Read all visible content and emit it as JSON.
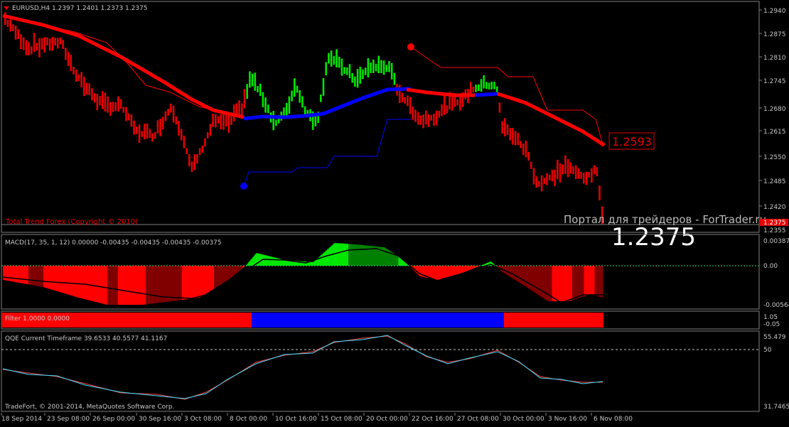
{
  "colors": {
    "background": "#000000",
    "panel_border": "#808080",
    "text": "#c8c8c8",
    "bull": "#00e600",
    "bear": "#e60000",
    "bear_dark": "#800000",
    "bull_dark": "#008000",
    "blue": "#0000ff",
    "red": "#ff0000",
    "qqe_line1": "#ff4040",
    "qqe_line2": "#40e0ff"
  },
  "main": {
    "symbol_arrow_icon": "triangle-down",
    "header": "EURUSD,H4  1.2397 1.2401 1.2373 1.2375",
    "indicator_name": "Total Trend Forex (Copyright © 2010)",
    "watermark": "Портал для трейдеров - ForTrader.ru",
    "big_price": "1.2375",
    "ma_label": "1.2593",
    "current_price_tag": "1.2375",
    "price_axis": [
      "1.2940",
      "1.2875",
      "1.2810",
      "1.2745",
      "1.2680",
      "1.2615",
      "1.2550",
      "1.2485",
      "1.2420",
      "1.2355"
    ]
  },
  "macd": {
    "header": "MACD(17, 35, 1, 12) 0.00000 -0.00435 -0.00435 -0.00435 -0.00375",
    "axis": [
      "0.00387",
      "0.00",
      "-0.00564"
    ]
  },
  "filter": {
    "header": "Filter 1.0000 0.0000",
    "axis": [
      "1.05",
      "-0.05"
    ],
    "segments": [
      {
        "state": "bear",
        "from": "18 Sep 2014",
        "to": "8 Oct 00:00"
      },
      {
        "state": "bull",
        "from": "8 Oct 00:00",
        "to": "30 Oct 00:00"
      },
      {
        "state": "bear",
        "from": "30 Oct 00:00",
        "to": "6 Nov 08:00"
      }
    ]
  },
  "qqe": {
    "header": "QQE Current Timeframe 39.6533 40.5577 41.1167",
    "axis": [
      "55.479",
      "50",
      "31.7465"
    ],
    "copyright": "TradeFort, © 2001-2014, MetaQuotes Software Corp."
  },
  "time_axis": [
    "18 Sep 2014",
    "23 Sep 08:00",
    "26 Sep 00:00",
    "30 Sep 16:00",
    "3 Oct 08:00",
    "8 Oct 00:00",
    "10 Oct 16:00",
    "15 Oct 08:00",
    "20 Oct 00:00",
    "22 Oct 16:00",
    "27 Oct 08:00",
    "30 Oct 00:00",
    "3 Nov 16:00",
    "6 Nov 08:00"
  ],
  "chart_data": {
    "type": "line",
    "title": "EURUSD,H4",
    "series": [
      {
        "name": "EURUSD",
        "x": [
          "18 Sep 2014",
          "23 Sep 08:00",
          "26 Sep 00:00",
          "30 Sep 16:00",
          "3 Oct 08:00",
          "8 Oct 00:00",
          "10 Oct 16:00",
          "15 Oct 08:00",
          "20 Oct 00:00",
          "22 Oct 16:00",
          "27 Oct 08:00",
          "30 Oct 00:00",
          "3 Nov 16:00",
          "6 Nov 08:00"
        ],
        "values": [
          1.291,
          1.285,
          1.272,
          1.265,
          1.253,
          1.267,
          1.264,
          1.279,
          1.279,
          1.266,
          1.27,
          1.264,
          1.252,
          1.2375
        ]
      }
    ],
    "ylim": [
      1.2355,
      1.295
    ]
  }
}
